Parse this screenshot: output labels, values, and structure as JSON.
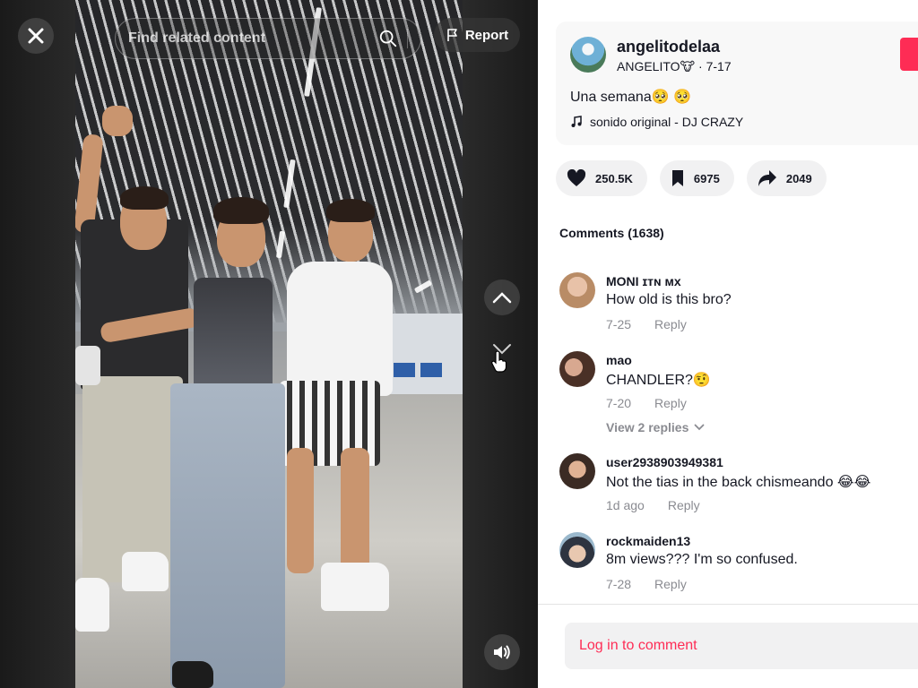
{
  "video": {
    "search_placeholder": "Find related content",
    "report_label": "Report",
    "icons": {
      "close": "close-icon",
      "search": "search-icon",
      "flag": "flag-icon",
      "up": "chevron-up-icon",
      "down": "chevron-down-icon",
      "volume": "volume-icon",
      "cursor": "hand-pointer-icon"
    }
  },
  "author": {
    "username": "angelitodelaa",
    "nickname": "ANGELITO🐮",
    "separator": "·",
    "date": "7-17",
    "caption": "Una semana🥺 🥺",
    "music": "sonido original - DJ CRAZY",
    "music_icon": "music-note-icon"
  },
  "actions": {
    "likes": "250.5K",
    "saves": "6975",
    "shares": "2049",
    "icons": [
      "heart-icon",
      "bookmark-icon",
      "share-icon"
    ]
  },
  "comments_header": "Comments (1638)",
  "comments": [
    {
      "user": "MONI ɪᴛɴ ᴍx",
      "text": "How old is this bro?",
      "date": "7-25",
      "reply": "Reply"
    },
    {
      "user": "mao",
      "text": "CHANDLER?🤨",
      "date": "7-20",
      "reply": "Reply"
    },
    {
      "user": "user2938903949381",
      "text": "Not the tias in the back chismeando 😂😂",
      "date": "1d ago",
      "reply": "Reply"
    },
    {
      "user": "rockmaiden13",
      "text": "8m views??? I'm so confused.",
      "date": "7-28",
      "reply": "Reply"
    }
  ],
  "view_replies": "View 2 replies",
  "login_prompt": "Log in to comment",
  "colors": {
    "accent": "#fe2c55",
    "text": "#161823",
    "muted": "#8a8b91",
    "pill": "#f1f1f2"
  }
}
